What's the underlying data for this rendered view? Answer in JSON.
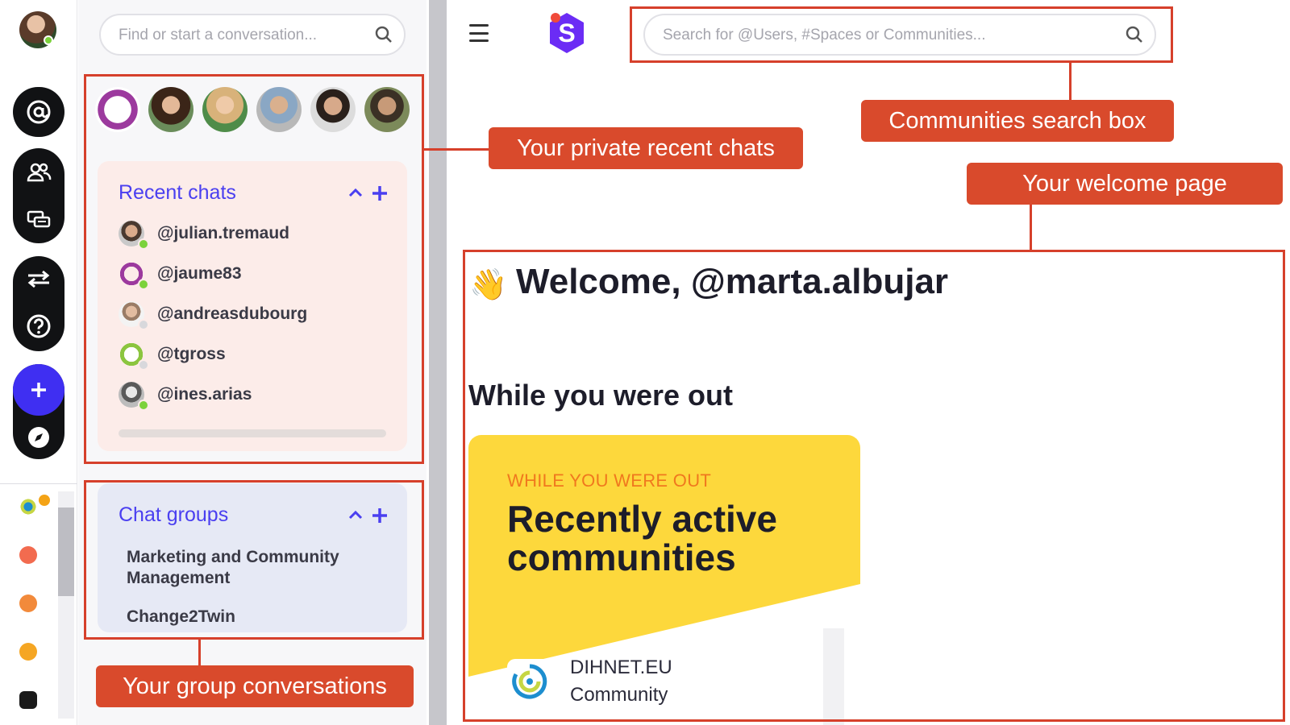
{
  "left_panel": {
    "search_placeholder": "Find or start a conversation...",
    "recent_chats": {
      "title": "Recent chats",
      "collapse_symbol": "^",
      "add_symbol": "+",
      "items": [
        {
          "name": "@julian.tremaud",
          "status": "online"
        },
        {
          "name": "@jaume83",
          "status": "online"
        },
        {
          "name": "@andreasdubourg",
          "status": "offline"
        },
        {
          "name": "@tgross",
          "status": "offline"
        },
        {
          "name": "@ines.arias",
          "status": "online"
        }
      ]
    },
    "chat_groups": {
      "title": "Chat groups",
      "collapse_symbol": "^",
      "add_symbol": "+",
      "items": [
        {
          "name": "Marketing and Community Management"
        },
        {
          "name": "Change2Twin"
        }
      ]
    }
  },
  "main": {
    "search_placeholder": "Search for @Users, #Spaces or Communities...",
    "welcome": "Welcome, @marta.albujar",
    "section_heading": "While you were out",
    "card": {
      "kicker": "WHILE YOU WERE OUT",
      "title": "Recently active communities",
      "community": {
        "name_line1": "DIHNET.EU",
        "name_line2": "Community"
      }
    }
  },
  "annotations": {
    "recent_chats": "Your private recent chats",
    "search_box": "Communities search box",
    "welcome_page": "Your welcome page",
    "group_conversations": "Your group conversations"
  },
  "colors": {
    "accent": "#4a3ff0",
    "annotation": "#d6402b",
    "card_yellow": "#fdd83c",
    "online": "#7bd23b",
    "offline": "#d8d8dc"
  }
}
